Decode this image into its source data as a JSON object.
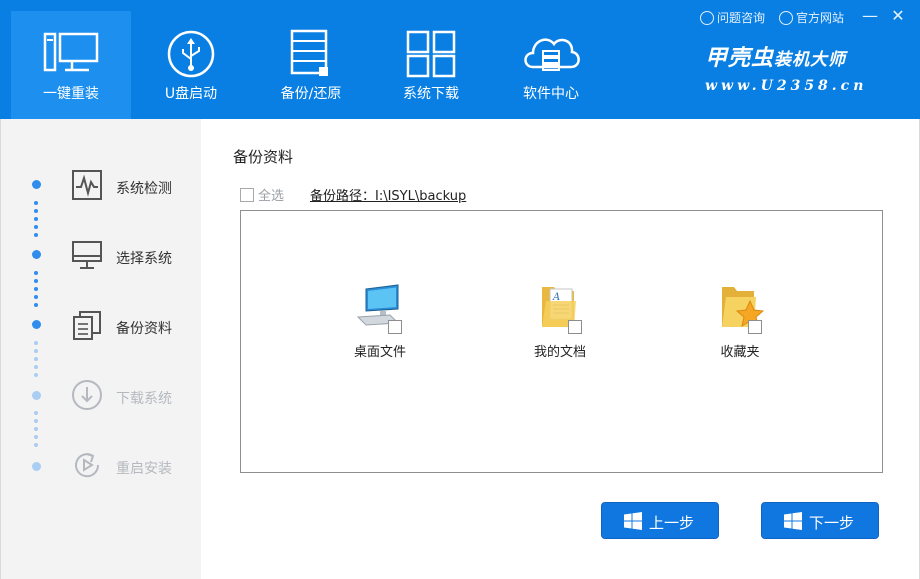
{
  "nav": {
    "items": [
      {
        "label": "一键重装",
        "icon": "monitor-icon"
      },
      {
        "label": "U盘启动",
        "icon": "usb-icon"
      },
      {
        "label": "备份/还原",
        "icon": "backup-icon"
      },
      {
        "label": "系统下载",
        "icon": "grid-icon"
      },
      {
        "label": "软件中心",
        "icon": "cloud-icon"
      }
    ]
  },
  "topbar": {
    "help_label": "问题咨询",
    "site_label": "官方网站",
    "minimize": "—",
    "close": "✕"
  },
  "brand": {
    "title_a": "甲壳虫",
    "title_b": "装机大师",
    "url": "www.U2358.cn"
  },
  "steps": [
    {
      "label": "系统检测",
      "state": "done",
      "icon": "chart-icon"
    },
    {
      "label": "选择系统",
      "state": "done",
      "icon": "desktop-icon"
    },
    {
      "label": "备份资料",
      "state": "done",
      "icon": "documents-icon"
    },
    {
      "label": "下载系统",
      "state": "todo",
      "icon": "download-icon"
    },
    {
      "label": "重启安装",
      "state": "todo",
      "icon": "restart-icon"
    }
  ],
  "main": {
    "title": "备份资料",
    "select_all": "全选",
    "backup_path": "备份路径：I:\\ISYL\\backup",
    "files": [
      {
        "label": "桌面文件",
        "icon": "desktop-computer-icon"
      },
      {
        "label": "我的文档",
        "icon": "folder-documents-icon"
      },
      {
        "label": "收藏夹",
        "icon": "favorites-folder-icon"
      }
    ],
    "prev_label": "上一步",
    "next_label": "下一步"
  },
  "colors": {
    "header": "#0a7fe3",
    "active_tab": "#1d8fef",
    "button": "#1177e0",
    "step_done": "#2f8ded",
    "step_todo": "#aacdf3"
  }
}
